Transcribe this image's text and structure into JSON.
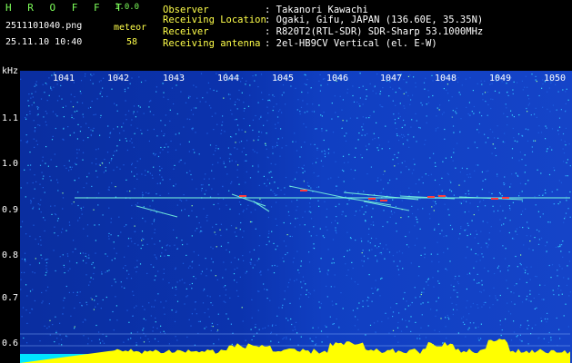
{
  "app": {
    "title": "H R O F F T",
    "version": "1.0.0"
  },
  "capture": {
    "filename": "2511101040.png",
    "datetime": "25.11.10 10:40"
  },
  "meteor": {
    "label": "meteor",
    "count": "58"
  },
  "station": [
    {
      "label": "Observer",
      "value": ": Takanori Kawachi"
    },
    {
      "label": "Receiving Location",
      "value": ": Ogaki, Gifu, JAPAN (136.60E, 35.35N)"
    },
    {
      "label": "Receiver",
      "value": ": R820T2(RTL-SDR) SDR-Sharp 53.1000MHz"
    },
    {
      "label": "Receiving antenna",
      "value": ": 2el-HB9CV Vertical (el. E-W)"
    }
  ],
  "spectrogram": {
    "y_unit": "kHz",
    "x_ticks": [
      "1041",
      "1042",
      "1043",
      "1044",
      "1045",
      "1046",
      "1047",
      "1048",
      "1049",
      "1050"
    ],
    "y_ticks": [
      "1.1",
      "1.0",
      "0.9",
      "0.8",
      "0.7",
      "0.6"
    ],
    "colors": {
      "background": "#0b33ae",
      "signal_line": "#7dffe0",
      "echo": "#ff3b3b",
      "noise_floor": "#ffff00",
      "cyan_band": "#00e5ff"
    }
  }
}
